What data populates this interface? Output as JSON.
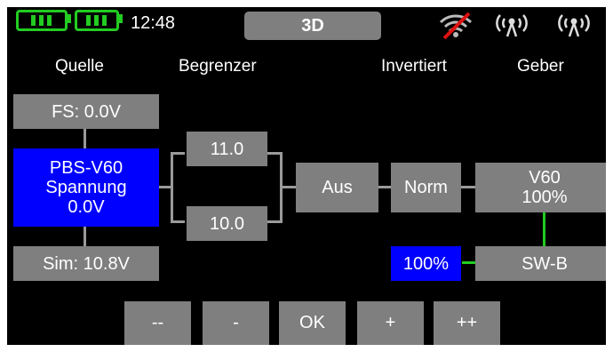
{
  "status": {
    "time": "12:48",
    "mode": "3D",
    "icons": [
      "battery-icon",
      "battery-icon",
      "no-signal-icon",
      "antenna-icon",
      "antenna-icon"
    ],
    "accent": "#22cc22"
  },
  "headers": {
    "quelle": "Quelle",
    "begrenzer": "Begrenzer",
    "invertiert": "Invertiert",
    "geber": "Geber"
  },
  "boxes": {
    "failsafe": "FS: 0.0V",
    "source_line1": "PBS-V60",
    "source_line2": "Spannung",
    "source_line3": "0.0V",
    "simulation": "Sim: 10.8V",
    "limit_upper": "11.0",
    "limit_lower": "10.0",
    "aus": "Aus",
    "norm": "Norm",
    "geber_line1": "V60",
    "geber_line2": "100%",
    "percent": "100%",
    "switch": "SW-B"
  },
  "buttons": {
    "dec_fast": "--",
    "dec": "-",
    "ok": "OK",
    "inc": "+",
    "inc_fast": "++"
  },
  "colors": {
    "selected": "#0000ff",
    "box": "#7f7f7f",
    "link": "#22cc22"
  }
}
